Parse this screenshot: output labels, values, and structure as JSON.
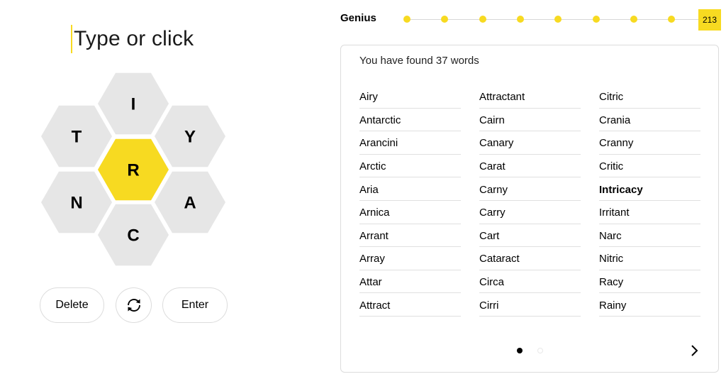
{
  "input": {
    "placeholder": "Type or click"
  },
  "hive": {
    "center_letter": "R",
    "outer_letters": [
      "I",
      "Y",
      "A",
      "C",
      "N",
      "T"
    ],
    "center_color": "#f7da21",
    "outer_color": "#e6e6e6"
  },
  "controls": {
    "delete_label": "Delete",
    "shuffle_icon": "shuffle-icon",
    "enter_label": "Enter"
  },
  "progress": {
    "rank": "Genius",
    "score": "213",
    "accent_color": "#f7da21"
  },
  "words": {
    "found_text": "You have found 37 words",
    "columns": [
      [
        "Airy",
        "Antarctic",
        "Arancini",
        "Arctic",
        "Aria",
        "Arnica",
        "Arrant",
        "Array",
        "Attar",
        "Attract"
      ],
      [
        "Attractant",
        "Cairn",
        "Canary",
        "Carat",
        "Carny",
        "Carry",
        "Cart",
        "Cataract",
        "Circa",
        "Cirri"
      ],
      [
        "Citric",
        "Crania",
        "Cranny",
        "Critic",
        "Intricacy",
        "Irritant",
        "Narc",
        "Nitric",
        "Racy",
        "Rainy"
      ]
    ],
    "highlighted_word": "Intricacy",
    "pagination": {
      "current_page": 1,
      "total_pages": 2
    }
  }
}
